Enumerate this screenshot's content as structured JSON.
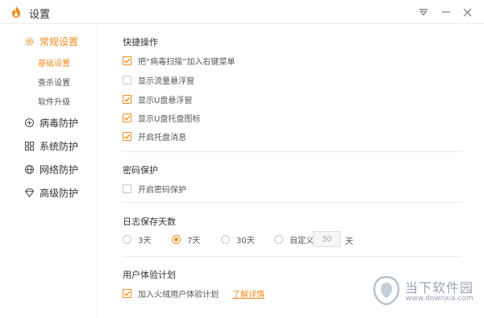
{
  "window": {
    "title": "设置"
  },
  "sidebar": {
    "items": [
      {
        "label": "常规设置",
        "icon": "gear-icon",
        "active": true
      },
      {
        "label": "病毒防护",
        "icon": "virus-icon",
        "active": false
      },
      {
        "label": "系统防护",
        "icon": "system-icon",
        "active": false
      },
      {
        "label": "网络防护",
        "icon": "globe-icon",
        "active": false
      },
      {
        "label": "高级防护",
        "icon": "diamond-icon",
        "active": false
      }
    ],
    "subitems": [
      {
        "label": "基础设置",
        "active": true
      },
      {
        "label": "查杀设置",
        "active": false
      },
      {
        "label": "软件升级",
        "active": false
      }
    ]
  },
  "quick_ops": {
    "title": "快捷操作",
    "options": [
      {
        "label": "把“病毒扫描”加入右键菜单",
        "checked": true
      },
      {
        "label": "显示流量悬浮窗",
        "checked": false
      },
      {
        "label": "显示U盘悬浮窗",
        "checked": true
      },
      {
        "label": "显示U盘托盘图标",
        "checked": true
      },
      {
        "label": "开启托盘消息",
        "checked": true
      }
    ]
  },
  "password": {
    "title": "密码保护",
    "option": {
      "label": "开启密码保护",
      "checked": false
    }
  },
  "log": {
    "title": "日志保存天数",
    "options": [
      {
        "label": "3天",
        "checked": false
      },
      {
        "label": "7天",
        "checked": true
      },
      {
        "label": "30天",
        "checked": false
      },
      {
        "label": "自定义",
        "checked": false
      }
    ],
    "custom_value": "30",
    "unit": "天"
  },
  "experience": {
    "title": "用户体验计划",
    "option": {
      "label": "加入火绒用户体验计划",
      "checked": true
    },
    "link": "了解详情"
  },
  "watermark": {
    "name": "当下软件园",
    "url": "www.downxia.com"
  },
  "colors": {
    "accent": "#f08c1e"
  }
}
